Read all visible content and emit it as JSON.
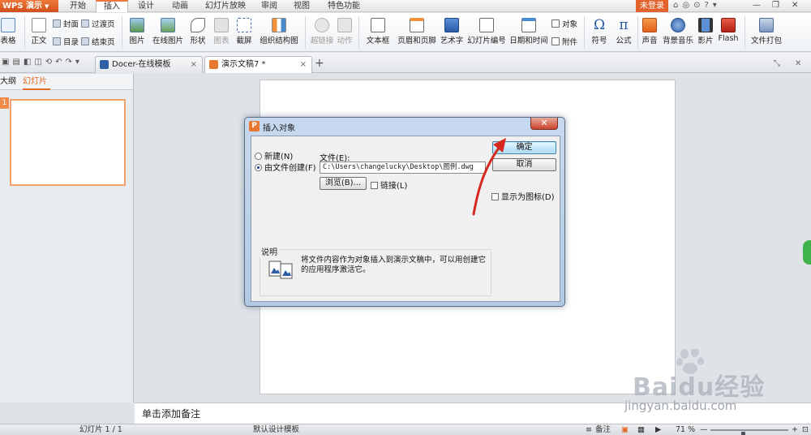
{
  "menubar": {
    "app_label": "WPS 演示",
    "tabs": [
      "开始",
      "插入",
      "设计",
      "动画",
      "幻灯片放映",
      "审阅",
      "视图",
      "特色功能"
    ],
    "active_tab": "插入",
    "login_label": "未登录"
  },
  "ribbon": {
    "table": "表格",
    "text_body": "正文",
    "cover": "封面",
    "catalog": "目录",
    "transition_page": "过渡页",
    "end_page": "结束页",
    "picture": "图片",
    "online_picture": "在线图片",
    "shapes": "形状",
    "chart": "图表",
    "screenshot": "截屏",
    "org_chart": "组织结构图",
    "hyperlink": "超链接",
    "action": "动作",
    "textbox": "文本框",
    "header_footer": "页眉和页脚",
    "wordart": "艺术字",
    "slide_number": "幻灯片编号",
    "datetime": "日期和时间",
    "object": "对象",
    "attachment": "附件",
    "symbol": "符号",
    "formula": "公式",
    "sound": "声音",
    "bg_music": "背景音乐",
    "movie": "影片",
    "flash": "Flash",
    "package": "文件打包"
  },
  "doc_tabs": [
    {
      "label": "Docer-在线模板"
    },
    {
      "label": "演示文稿7 *"
    }
  ],
  "left_panel": {
    "tab_outline": "大纲",
    "tab_slides": "幻灯片",
    "slide_number": "1"
  },
  "notes_placeholder": "单击添加备注",
  "status": {
    "slide_counter": "幻灯片 1 / 1",
    "template": "默认设计模板",
    "notes": "备注",
    "zoom": "71 %",
    "zoom_fraction": 0.71
  },
  "dialog": {
    "title": "插入对象",
    "radio_new": "新建(N)",
    "radio_from_file": "由文件创建(F)",
    "file_label": "文件(E):",
    "file_path": "C:\\Users\\changelucky\\Desktop\\图例.dwg",
    "browse": "浏览(B)...",
    "link": "链接(L)",
    "ok": "确定",
    "cancel": "取消",
    "display_as_icon": "显示为图标(D)",
    "description_title": "说明",
    "description_text": "将文件内容作为对象插入到演示文稿中，可以用创建它的应用程序激活它。"
  },
  "watermark": {
    "brand": "Baidu经验",
    "url": "jingyan.baidu.com"
  },
  "colors": {
    "accent_orange": "#f07838",
    "login_red": "#e2622c",
    "annotation_red": "#d6281e"
  }
}
